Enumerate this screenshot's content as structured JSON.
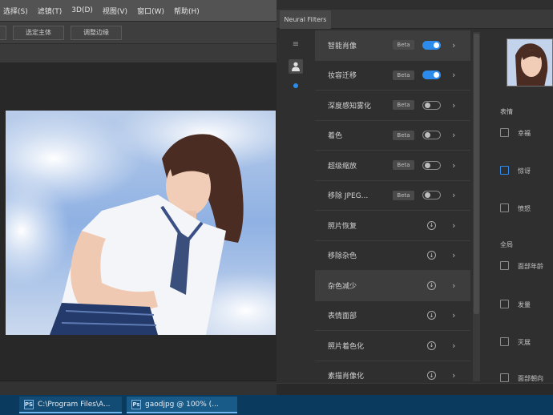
{
  "app": {
    "menubar": [
      "选择(S)",
      "滤镜(T)",
      "3D(D)",
      "视图(V)",
      "窗口(W)",
      "帮助(H)"
    ],
    "options": {
      "btn1": "选定主体",
      "btn2": "调整边缘"
    }
  },
  "panel": {
    "tab": "Neural Filters"
  },
  "filters": [
    {
      "name": "智能肖像",
      "beta": "Beta",
      "state": "on"
    },
    {
      "name": "妆容迁移",
      "beta": "Beta",
      "state": "on"
    },
    {
      "name": "深度感知雾化",
      "beta": "Beta",
      "state": "off"
    },
    {
      "name": "着色",
      "beta": "Beta",
      "state": "off"
    },
    {
      "name": "超级缩放",
      "beta": "Beta",
      "state": "off"
    },
    {
      "name": "移除 JPEG...",
      "beta": "Beta",
      "state": "off"
    },
    {
      "name": "照片恢复",
      "state": "cloud"
    },
    {
      "name": "移除杂色",
      "state": "cloud"
    },
    {
      "name": "杂色减少",
      "state": "cloud"
    },
    {
      "name": "表情面部",
      "state": "cloud"
    },
    {
      "name": "照片着色化",
      "state": "cloud"
    },
    {
      "name": "素描肖像化",
      "state": "cloud"
    }
  ],
  "settings": {
    "section1": "表情",
    "options1": [
      "幸福",
      "惊讶",
      "愤怒"
    ],
    "section2": "全局",
    "options2": [
      "面部年龄",
      "发量",
      "灭展",
      "面部朝向"
    ]
  },
  "taskbar": {
    "items": [
      {
        "label": "C:\\Program Files\\A...",
        "icon": "PS"
      },
      {
        "label": "gaodjpg @ 100% (...",
        "icon": "Ps"
      }
    ]
  },
  "colors": {
    "accent": "#2d8ceb",
    "panel_bg": "#2f2f2f",
    "taskbar": "#0a3b5e"
  }
}
